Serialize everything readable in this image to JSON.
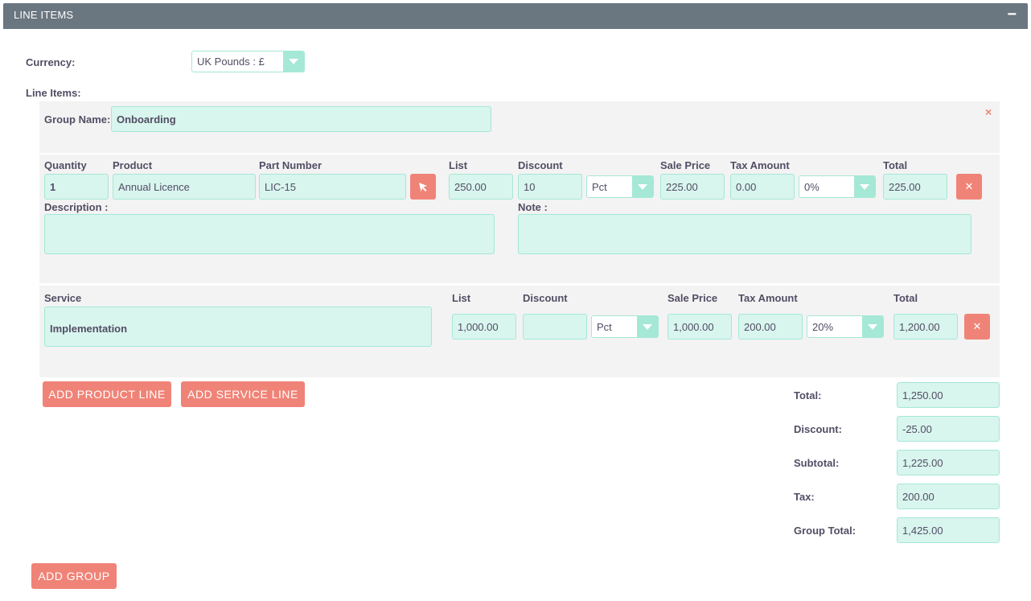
{
  "panel": {
    "title": "LINE ITEMS",
    "collapse_symbol": "−"
  },
  "currency": {
    "label": "Currency:",
    "value": "UK Pounds : £"
  },
  "line_items_label": "Line Items:",
  "group": {
    "name_label": "Group Name:",
    "name_value": "Onboarding",
    "close_symbol": "×",
    "product_headers": {
      "quantity": "Quantity",
      "product": "Product",
      "part_number": "Part Number",
      "list": "List",
      "discount": "Discount",
      "sale_price": "Sale Price",
      "tax_amount": "Tax Amount",
      "total": "Total"
    },
    "product_line": {
      "quantity": "1",
      "product": "Annual Licence",
      "part_number": "LIC-15",
      "list": "250.00",
      "discount": "10",
      "discount_type": "Pct",
      "sale_price": "225.00",
      "tax_amount": "0.00",
      "tax_rate": "0%",
      "total": "225.00",
      "description_label": "Description :",
      "note_label": "Note :"
    },
    "service_headers": {
      "service": "Service",
      "list": "List",
      "discount": "Discount",
      "sale_price": "Sale Price",
      "tax_amount": "Tax Amount",
      "total": "Total"
    },
    "service_line": {
      "service": "Implementation",
      "list": "1,000.00",
      "discount": "",
      "discount_type": "Pct",
      "sale_price": "1,000.00",
      "tax_amount": "200.00",
      "tax_rate": "20%",
      "total": "1,200.00"
    },
    "buttons": {
      "add_product_line": "ADD PRODUCT LINE",
      "add_service_line": "ADD SERVICE LINE"
    },
    "totals": {
      "total_label": "Total:",
      "total_value": "1,250.00",
      "discount_label": "Discount:",
      "discount_value": "-25.00",
      "subtotal_label": "Subtotal:",
      "subtotal_value": "1,225.00",
      "tax_label": "Tax:",
      "tax_value": "200.00",
      "group_total_label": "Group Total:",
      "group_total_value": "1,425.00"
    }
  },
  "add_group_button": "ADD GROUP",
  "icons": {
    "select_product": "cursor-arrow-icon",
    "remove": "close-icon"
  },
  "colors": {
    "header": "#6a7680",
    "accent": "#f08377",
    "field": "#d8f5ee",
    "field_border": "#a5e8d6"
  }
}
